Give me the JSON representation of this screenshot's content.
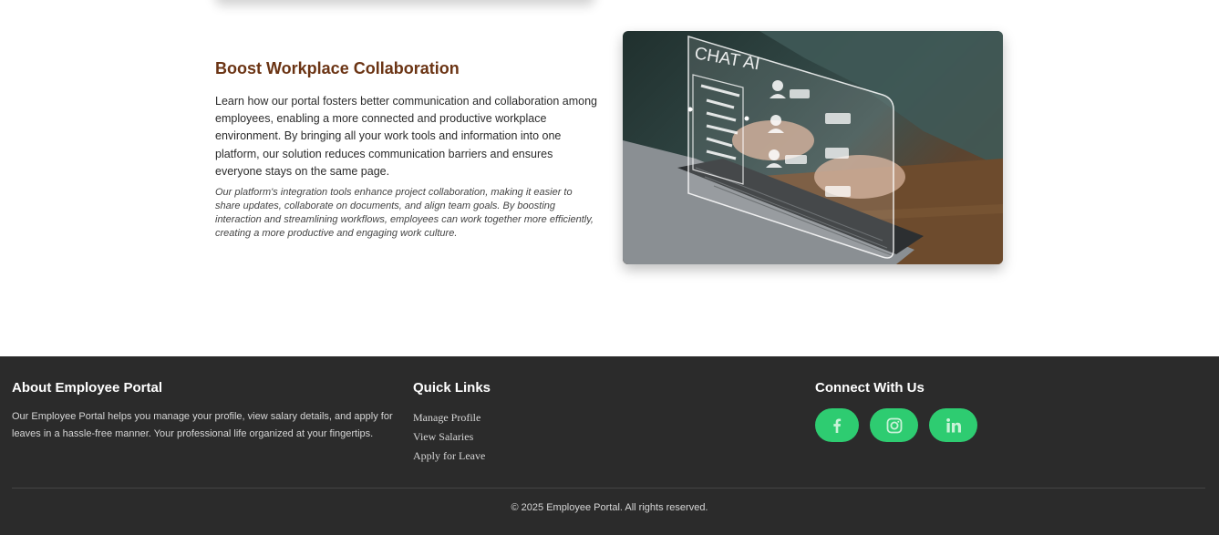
{
  "feature": {
    "title": "Boost Workplace Collaboration",
    "body": "Learn how our portal fosters better communication and collaboration among employees, enabling a more connected and productive workplace environment. By bringing all your work tools and information into one platform, our solution reduces communication barriers and ensures everyone stays on the same page.",
    "note": "Our platform's integration tools enhance project collaboration, making it easier to share updates, collaborate on documents, and align team goals. By boosting interaction and streamlining workflows, employees can work together more efficiently, creating a more productive and engaging work culture.",
    "image_caption": "CHAT AI"
  },
  "footer": {
    "about": {
      "heading": "About Employee Portal",
      "text": "Our Employee Portal helps you manage your profile, view salary details, and apply for leaves in a hassle-free manner. Your professional life organized at your fingertips."
    },
    "quick_links": {
      "heading": "Quick Links",
      "items": [
        "Manage Profile",
        "View Salaries",
        "Apply for Leave"
      ]
    },
    "connect": {
      "heading": "Connect With Us",
      "icons": [
        "facebook-icon",
        "instagram-icon",
        "linkedin-icon"
      ],
      "accent": "#2ecc71"
    },
    "copyright": "© 2025 Employee Portal. All rights reserved."
  },
  "colors": {
    "title": "#6b3414",
    "footer_bg": "#2b2b2b",
    "social_bg": "#2ecc71"
  }
}
